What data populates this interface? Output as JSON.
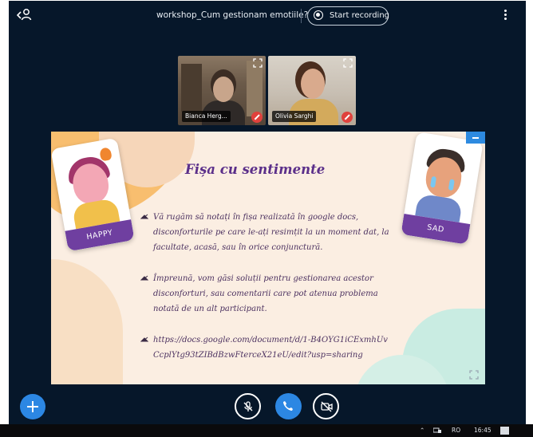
{
  "meeting": {
    "title": "workshop_Cum gestionam emotiile?",
    "record_label": "Start recording"
  },
  "participants": [
    {
      "name": "Bianca Herg..."
    },
    {
      "name": "Olivia Sarghi"
    }
  ],
  "slide": {
    "title": "Fișa cu sentimente",
    "card_left": "HAPPY",
    "card_right": "SAD",
    "bullets": [
      "Vă rugăm să notați în fișa realizată în google docs, disconforturile pe care le-ați resimțit la un moment dat, la facultate, acasă, sau în orice conjunctură.",
      "Împreună, vom găsi soluții pentru gestionarea acestor disconforturi, sau comentarii care pot atenua problema notată de un alt participant.",
      "https://docs.google.com/document/d/1-B4OYG1iCExmhUvCcplYtg93tZIBdBzwFterceX21eU/edit?usp=sharing"
    ]
  },
  "taskbar": {
    "language": "RO",
    "time": "16:45"
  },
  "colors": {
    "background": "#06172a",
    "accent": "#2c87e3",
    "slide_title": "#5b2f8a"
  }
}
